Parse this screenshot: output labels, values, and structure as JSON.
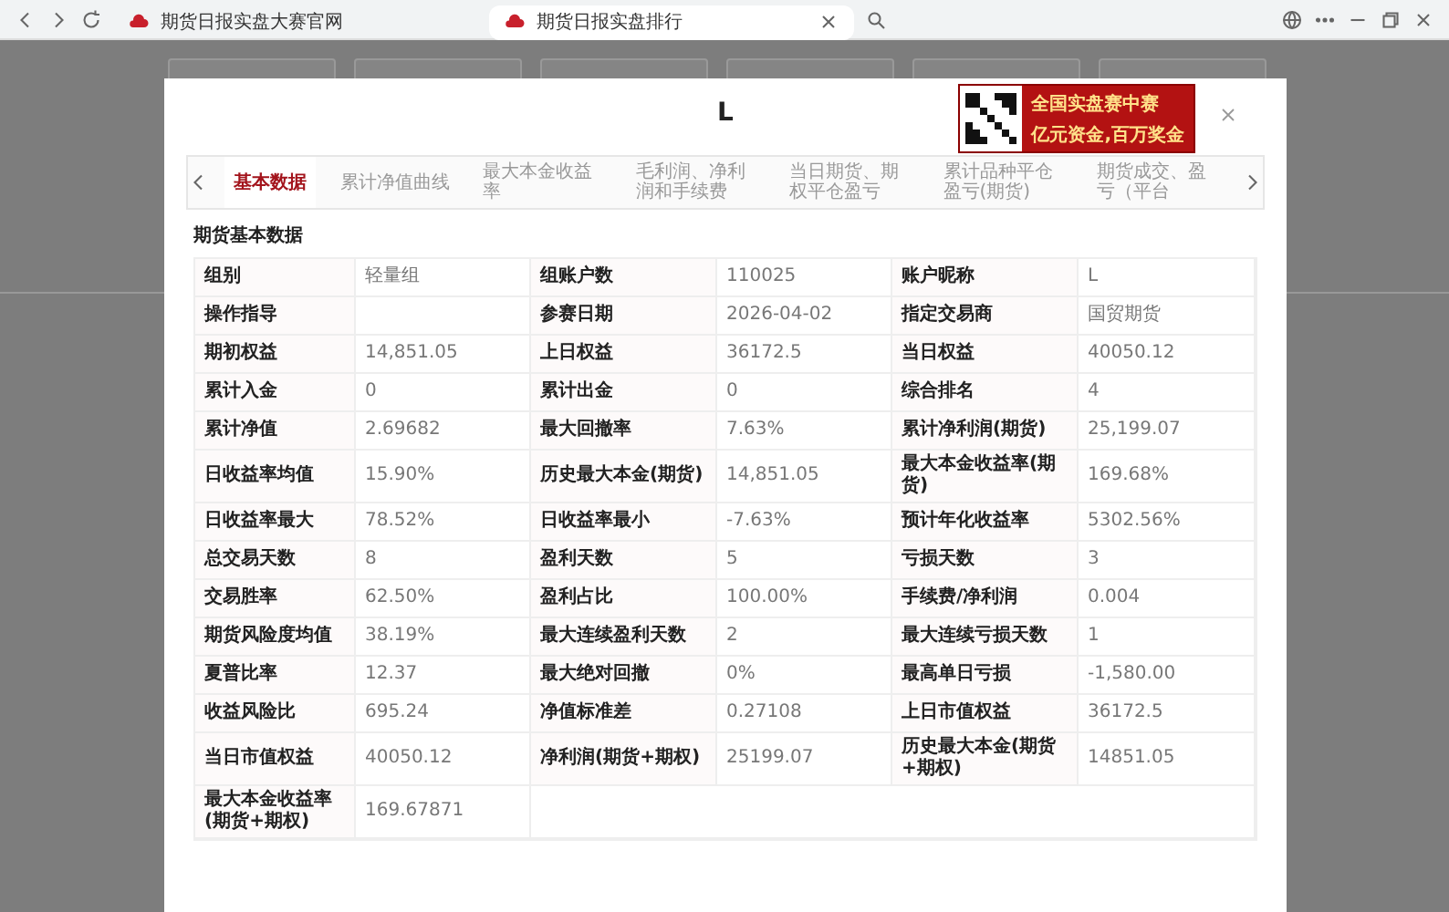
{
  "browser": {
    "tabs": [
      {
        "title": "期货日报实盘大赛官网",
        "selected": false
      },
      {
        "title": "期货日报实盘排行",
        "selected": true
      }
    ]
  },
  "modal": {
    "title": "L",
    "ad": {
      "line1": "全国实盘赛中赛",
      "line2": "亿元资金,百万奖金"
    },
    "tabs": [
      {
        "label": "基本数据",
        "selected": true
      },
      {
        "label": "累计净值曲线",
        "selected": false
      },
      {
        "label": "最大本金收益率",
        "selected": false
      },
      {
        "label": "毛利润、净利润和手续费",
        "selected": false
      },
      {
        "label": "当日期货、期权平仓盈亏",
        "selected": false
      },
      {
        "label": "累计品种平仓盈亏(期货)",
        "selected": false
      },
      {
        "label": "期货成交、盈亏（平台",
        "selected": false
      }
    ],
    "section_title": "期货基本数据",
    "rows": [
      [
        [
          "组别",
          "轻量组"
        ],
        [
          "组账户数",
          "110025"
        ],
        [
          "账户昵称",
          "L"
        ]
      ],
      [
        [
          "操作指导",
          ""
        ],
        [
          "参赛日期",
          "2026-04-02"
        ],
        [
          "指定交易商",
          "国贸期货"
        ]
      ],
      [
        [
          "期初权益",
          "14,851.05"
        ],
        [
          "上日权益",
          "36172.5"
        ],
        [
          "当日权益",
          "40050.12"
        ]
      ],
      [
        [
          "累计入金",
          "0"
        ],
        [
          "累计出金",
          "0"
        ],
        [
          "综合排名",
          "4"
        ]
      ],
      [
        [
          "累计净值",
          "2.69682"
        ],
        [
          "最大回撤率",
          "7.63%"
        ],
        [
          "累计净利润(期货)",
          "25,199.07"
        ]
      ],
      [
        [
          "日收益率均值",
          "15.90%"
        ],
        [
          "历史最大本金(期货)",
          "14,851.05"
        ],
        [
          "最大本金收益率(期货)",
          "169.68%"
        ]
      ],
      [
        [
          "日收益率最大",
          "78.52%"
        ],
        [
          "日收益率最小",
          "-7.63%"
        ],
        [
          "预计年化收益率",
          "5302.56%"
        ]
      ],
      [
        [
          "总交易天数",
          "8"
        ],
        [
          "盈利天数",
          "5"
        ],
        [
          "亏损天数",
          "3"
        ]
      ],
      [
        [
          "交易胜率",
          "62.50%"
        ],
        [
          "盈利占比",
          "100.00%"
        ],
        [
          "手续费/净利润",
          "0.004"
        ]
      ],
      [
        [
          "期货风险度均值",
          "38.19%"
        ],
        [
          "最大连续盈利天数",
          "2"
        ],
        [
          "最大连续亏损天数",
          "1"
        ]
      ],
      [
        [
          "夏普比率",
          "12.37"
        ],
        [
          "最大绝对回撤",
          "0%"
        ],
        [
          "最高单日亏损",
          "-1,580.00"
        ]
      ],
      [
        [
          "收益风险比",
          "695.24"
        ],
        [
          "净值标准差",
          "0.27108"
        ],
        [
          "上日市值权益",
          "36172.5"
        ]
      ],
      [
        [
          "当日市值权益",
          "40050.12"
        ],
        [
          "净利润(期货+期权)",
          "25199.07"
        ],
        [
          "历史最大本金(期货+期权)",
          "14851.05"
        ]
      ],
      [
        [
          "最大本金收益率(期货+期权)",
          "169.67871"
        ]
      ]
    ]
  }
}
